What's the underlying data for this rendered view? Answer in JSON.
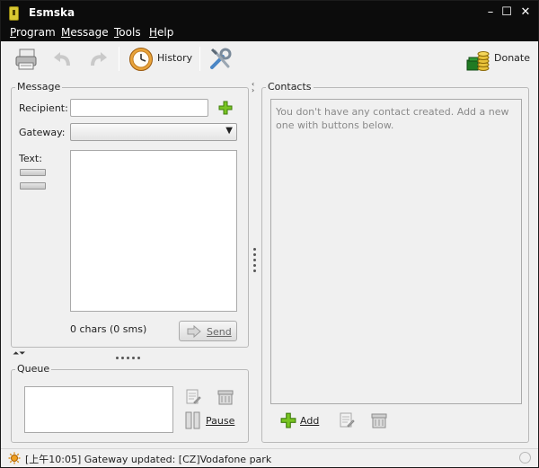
{
  "window": {
    "title": "Esmska",
    "min_glyph": "–",
    "max_glyph": "☐",
    "close_glyph": "✕"
  },
  "menu": {
    "items": [
      {
        "pre": "",
        "mnemonic": "P",
        "post": "rogram"
      },
      {
        "pre": "",
        "mnemonic": "M",
        "post": "essage"
      },
      {
        "pre": "",
        "mnemonic": "T",
        "post": "ools"
      },
      {
        "pre": "",
        "mnemonic": "H",
        "post": "elp"
      }
    ]
  },
  "toolbar": {
    "history_label": "History",
    "donate_label": "Donate"
  },
  "message": {
    "legend": "Message",
    "recipient_label": "Recipient:",
    "recipient_value": "",
    "gateway_label": "Gateway:",
    "gateway_value": "",
    "text_label": "Text:",
    "text_value": "",
    "counter": "0 chars (0 sms)",
    "send_label": "Send"
  },
  "queue": {
    "legend": "Queue",
    "pause_label": "Pause"
  },
  "contacts": {
    "legend": "Contacts",
    "empty_message": "You don't have any contact created. Add a new one with buttons below.",
    "add_label": "Add"
  },
  "status": {
    "text": "[上午10:05] Gateway updated: [CZ]Vodafone park"
  },
  "colors": {
    "titlebar": "#0c0c0c",
    "window_bg": "#f0f0f0",
    "accent_green": "#6cb81f"
  }
}
